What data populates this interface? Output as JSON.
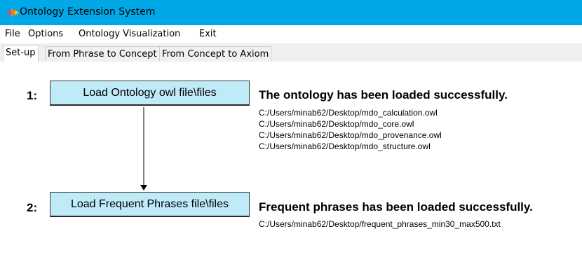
{
  "window": {
    "title": "Ontology Extension System",
    "app_icon": "app-logo-icon",
    "titlebar_color": "#00a8e8"
  },
  "menu": {
    "items": [
      "File",
      "Options",
      "Ontology Visualization",
      "Exit"
    ]
  },
  "tabs": {
    "items": [
      "Set-up",
      "From Phrase to Concept",
      "From Concept to Axiom"
    ],
    "active": "Set-up"
  },
  "steps": [
    {
      "number": "1:",
      "button_label": "Load Ontology owl file\\files",
      "status": "The ontology has been loaded successfully.",
      "files": [
        "C:/Users/minab62/Desktop/mdo_calculation.owl",
        "C:/Users/minab62/Desktop/mdo_core.owl",
        "C:/Users/minab62/Desktop/mdo_provenance.owl",
        "C:/Users/minab62/Desktop/mdo_structure.owl"
      ]
    },
    {
      "number": "2:",
      "button_label": "Load Frequent Phrases file\\files",
      "status": "Frequent phrases has been loaded successfully.",
      "files": [
        "C:/Users/minab62/Desktop/frequent_phrases_min30_max500.txt"
      ]
    }
  ],
  "colors": {
    "button_bg": "#bfeaf8",
    "tab_bg": "#f0f0f0"
  }
}
